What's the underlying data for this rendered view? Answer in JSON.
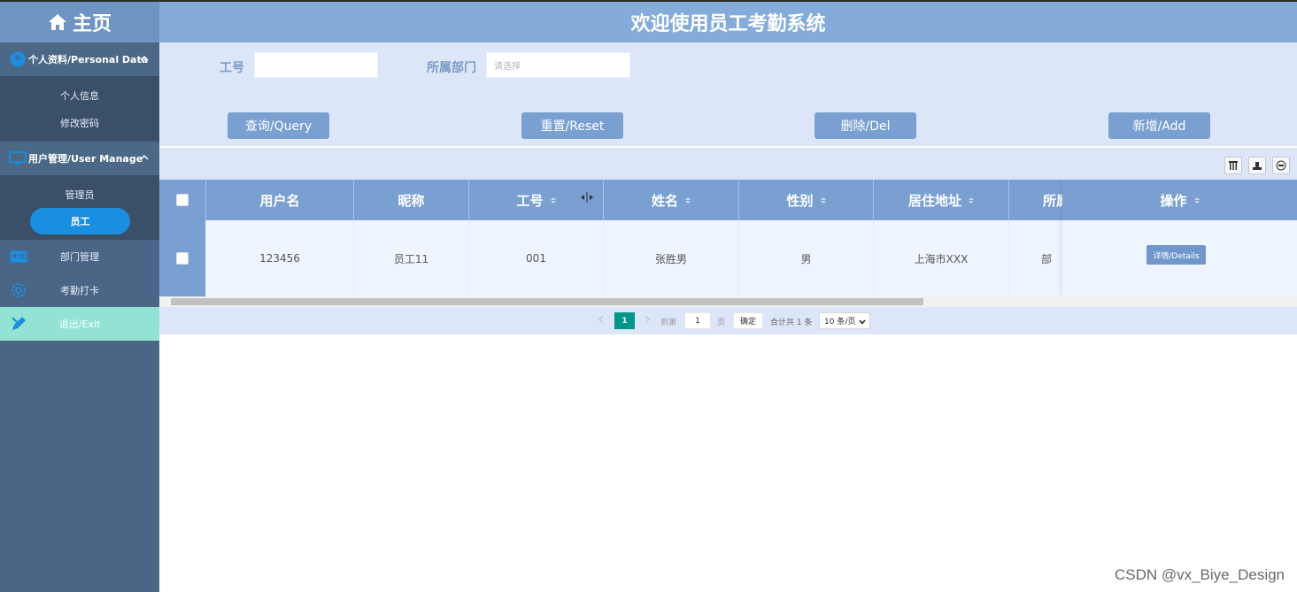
{
  "app": {
    "brand": "主页",
    "header_title": "欢迎使用员工考勤系统"
  },
  "sidebar": {
    "groups": [
      {
        "label": "个人资料/Personal Data",
        "items": [
          "个人信息",
          "修改密码"
        ]
      },
      {
        "label": "用户管理/User Manage",
        "items": [
          "管理员",
          "员工"
        ]
      }
    ],
    "active_item": "员工",
    "nav": [
      "部门管理",
      "考勤打卡",
      "退出/Exit"
    ]
  },
  "search": {
    "fields": [
      {
        "label": "工号",
        "value": "",
        "placeholder": ""
      },
      {
        "label": "所属部门",
        "value": "",
        "placeholder": "请选择"
      }
    ],
    "buttons": [
      "查询/Query",
      "重置/Reset",
      "删除/Del",
      "新增/Add"
    ]
  },
  "table": {
    "columns": [
      "用户名",
      "昵称",
      "工号",
      "姓名",
      "性别",
      "居住地址",
      "所属部门",
      "操作"
    ],
    "columns_visible": [
      "用户名",
      "昵称",
      "工号",
      "姓名",
      "性别",
      "居住地址",
      "所属"
    ],
    "rows": [
      {
        "username": "123456",
        "nickname": "员工11",
        "job_no": "001",
        "name": "张胜男",
        "gender": "男",
        "address": "上海市XXX",
        "dept": "部"
      }
    ],
    "action_label": "详情/Details"
  },
  "pager": {
    "current_page": "1",
    "goto_label": "到第",
    "goto_value": "1",
    "page_unit": "页",
    "confirm_label": "确定",
    "total_label": "合计共 1 条",
    "page_size": "10 条/页"
  },
  "watermark": "CSDN @vx_Biye_Design",
  "colors": {
    "sidebar": "#4a6585",
    "header": "#84abd9",
    "button": "#7aa0d1",
    "active": "#1a8fe0",
    "exit": "#92e3d3",
    "page_active": "#009688"
  }
}
